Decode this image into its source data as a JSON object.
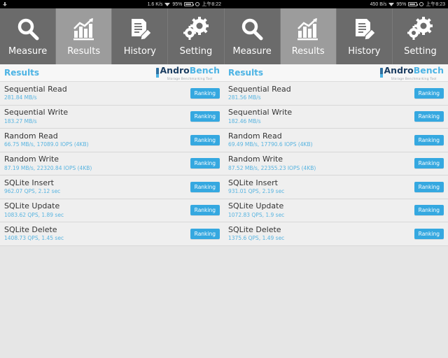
{
  "statusbar": {
    "left": {
      "download_icon": "download-arrow-icon",
      "network_speed": "1.6 K/s",
      "wifi_icon": "wifi-icon",
      "battery_percent": "95%",
      "battery_icon": "battery-icon",
      "alarm_icon": "alarm-icon",
      "time": "上午8:22"
    },
    "right": {
      "network_speed": "450 B/s",
      "wifi_icon": "wifi-icon",
      "battery_percent": "95%",
      "battery_icon": "battery-icon",
      "alarm_icon": "alarm-icon",
      "time": "上午8:23"
    }
  },
  "tabs": [
    {
      "label": "Measure",
      "icon": "magnifier-icon",
      "selected": false
    },
    {
      "label": "Results",
      "icon": "bar-chart-icon",
      "selected": true
    },
    {
      "label": "History",
      "icon": "document-pencil-icon",
      "selected": false
    },
    {
      "label": "Setting",
      "icon": "gears-icon",
      "selected": false
    },
    {
      "label": "Measure",
      "icon": "magnifier-icon",
      "selected": false
    },
    {
      "label": "Results",
      "icon": "bar-chart-icon",
      "selected": true
    },
    {
      "label": "History",
      "icon": "document-pencil-icon",
      "selected": false
    },
    {
      "label": "Setting",
      "icon": "gears-icon",
      "selected": false
    }
  ],
  "colors": {
    "accent_blue": "#35a8e0",
    "value_blue": "#58b4e0",
    "logo_dark": "#1d3f63",
    "tabbar_gray": "#6b6b6b",
    "tab_selected_gray": "#9c9c9c",
    "row_gray": "#efefef",
    "page_gray": "#e6e6e6"
  },
  "logo": {
    "word_1": "Andro",
    "word_2": "Bench",
    "subtitle": "Storage Benchmarking Tool"
  },
  "panels": [
    {
      "title": "Results",
      "rows": [
        {
          "name": "Sequential Read",
          "value": "281.84 MB/s",
          "button": "Ranking"
        },
        {
          "name": "Sequential Write",
          "value": "183.27 MB/s",
          "button": "Ranking"
        },
        {
          "name": "Random Read",
          "value": "66.75 MB/s, 17089.0 IOPS (4KB)",
          "button": "Ranking"
        },
        {
          "name": "Random Write",
          "value": "87.19 MB/s, 22320.84 IOPS (4KB)",
          "button": "Ranking"
        },
        {
          "name": "SQLite Insert",
          "value": "962.07 QPS, 2.12 sec",
          "button": "Ranking"
        },
        {
          "name": "SQLite Update",
          "value": "1083.62 QPS, 1.89 sec",
          "button": "Ranking"
        },
        {
          "name": "SQLite Delete",
          "value": "1408.73 QPS, 1.45 sec",
          "button": "Ranking"
        }
      ]
    },
    {
      "title": "Results",
      "rows": [
        {
          "name": "Sequential Read",
          "value": "281.56 MB/s",
          "button": "Ranking"
        },
        {
          "name": "Sequential Write",
          "value": "182.46 MB/s",
          "button": "Ranking"
        },
        {
          "name": "Random Read",
          "value": "69.49 MB/s, 17790.6 IOPS (4KB)",
          "button": "Ranking"
        },
        {
          "name": "Random Write",
          "value": "87.52 MB/s, 22355.23 IOPS (4KB)",
          "button": "Ranking"
        },
        {
          "name": "SQLite Insert",
          "value": "931.01 QPS, 2.19 sec",
          "button": "Ranking"
        },
        {
          "name": "SQLite Update",
          "value": "1072.83 QPS, 1.9 sec",
          "button": "Ranking"
        },
        {
          "name": "SQLite Delete",
          "value": "1375.6 QPS, 1.49 sec",
          "button": "Ranking"
        }
      ]
    }
  ]
}
